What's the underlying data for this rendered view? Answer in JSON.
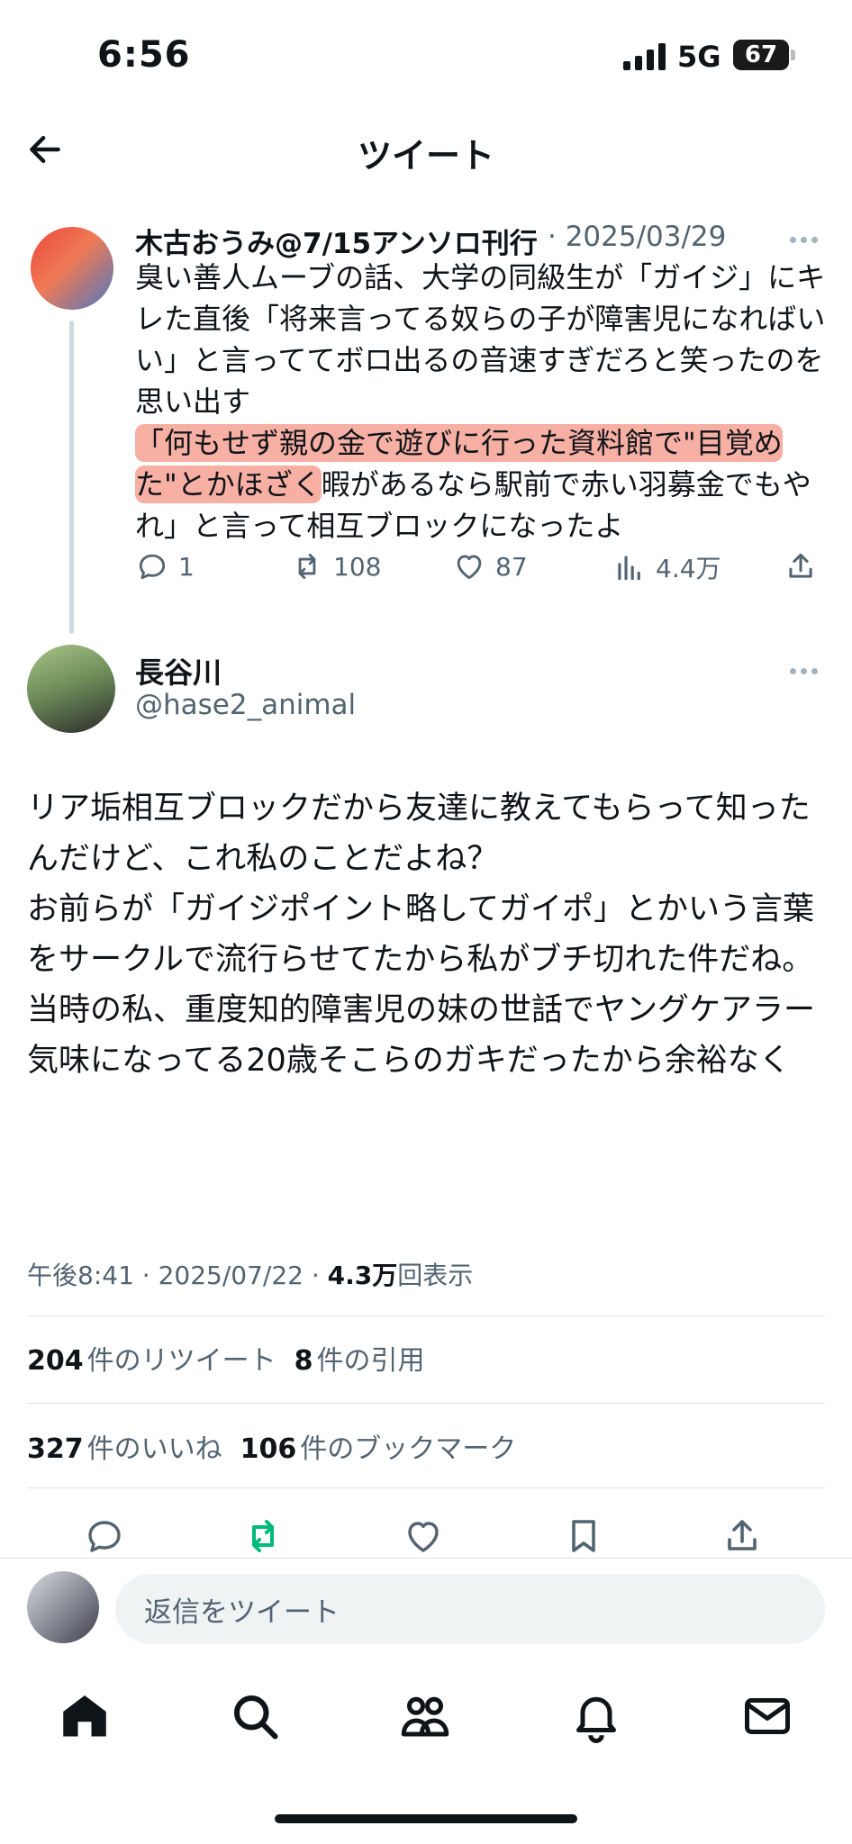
{
  "status_bar": {
    "time": "6:56",
    "network": "5G",
    "battery": "67"
  },
  "header": {
    "title": "ツイート"
  },
  "quoted_tweet": {
    "author": "木古おうみ@7/15アンソロ刊行",
    "date": "· 2025/03/29",
    "text_before": "臭い善人ムーブの話、大学の同級生が「ガイジ」にキレた直後「将来言ってる奴らの子が障害児になればいい」と言っててボロ出るの音速すぎだろと笑ったのを思い出す",
    "text_highlight": "「何もせず親の金で遊びに行った資料館で\"目覚めた\"とかほざく",
    "text_after": "暇があるなら駅前で赤い羽募金でもやれ」と言って相互ブロックになったよ",
    "replies": "1",
    "retweets": "108",
    "likes": "87",
    "views": "4.4万"
  },
  "main_tweet": {
    "author": "長谷川",
    "handle": "@hase2_animal",
    "text": "リア垢相互ブロックだから友達に教えてもらって知ったんだけど、これ私のことだよね？\nお前らが「ガイジポイント略してガイポ」とかいう言葉をサークルで流行らせてたから私がブチ切れた件だね。\n当時の私、重度知的障害児の妹の世話でヤングケアラー気味になってる20歳そこらのガキだったから余裕なく",
    "time_date": "午後8:41 · 2025/07/22 · ",
    "views_count": "4.3万",
    "views_label": "回表示",
    "retweets_count": "204",
    "retweets_label": "件のリツイート",
    "quotes_count": "8",
    "quotes_label": "件の引用",
    "likes_count": "327",
    "likes_label": "件のいいね",
    "bookmarks_count": "106",
    "bookmarks_label": "件のブックマーク"
  },
  "reply_bar": {
    "placeholder": "返信をツイート"
  },
  "icons": {
    "back": "arrow-left-icon",
    "more": "more-dots-icon",
    "reply": "speech-bubble-icon",
    "retweet": "retweet-icon",
    "like": "heart-icon",
    "views": "bar-chart-icon",
    "share": "share-icon",
    "bookmark": "bookmark-icon",
    "nav": [
      "home-icon",
      "search-icon",
      "communities-icon",
      "bell-icon",
      "mail-icon"
    ]
  },
  "colors": {
    "text": "#0f1419",
    "secondary": "#536471",
    "retweet_active": "#00ba7c",
    "highlight": "#f06e5a"
  }
}
